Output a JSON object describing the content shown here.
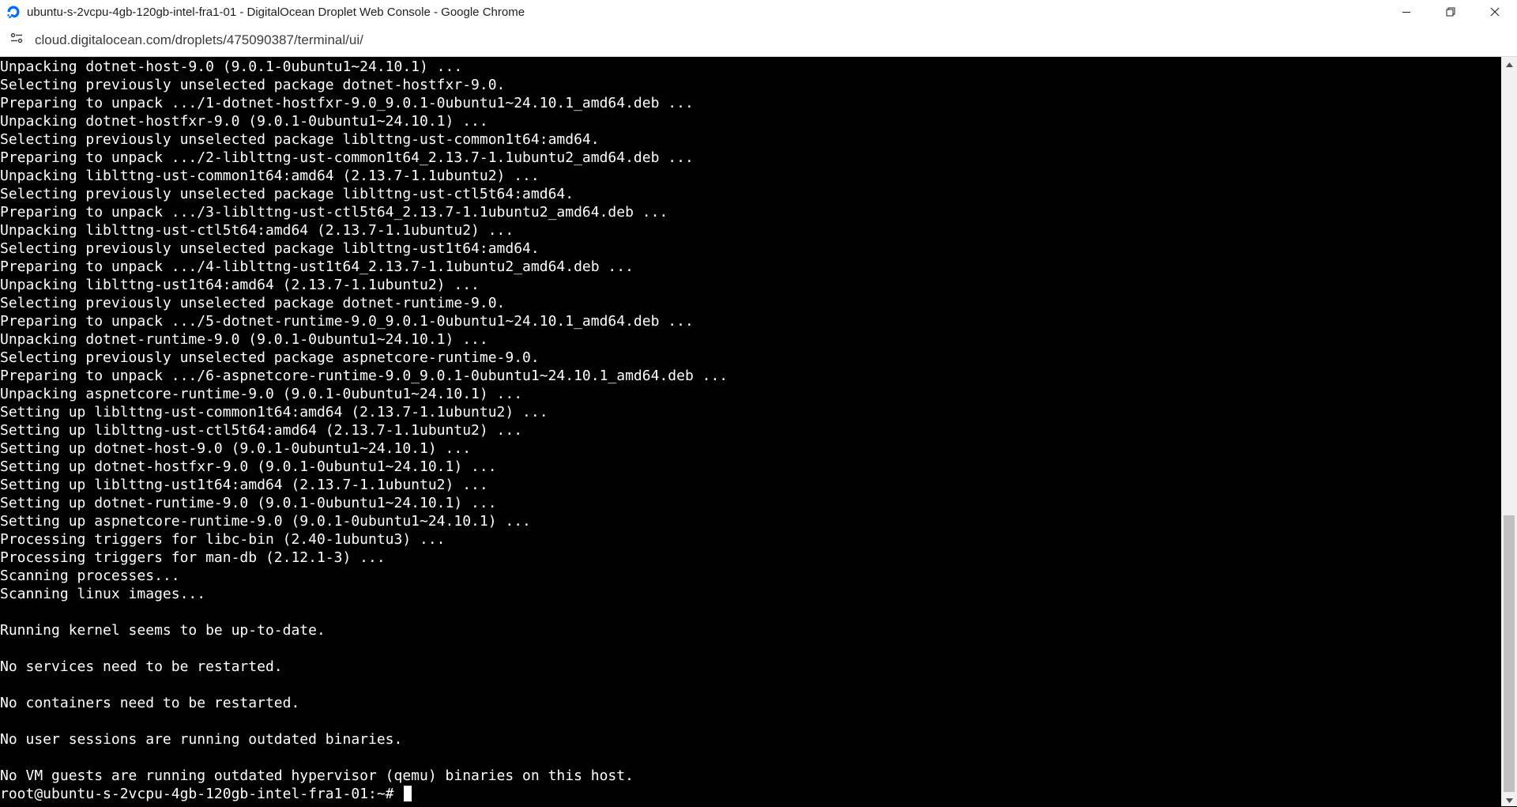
{
  "window": {
    "title": "ubuntu-s-2vcpu-4gb-120gb-intel-fra1-01 - DigitalOcean Droplet Web Console - Google Chrome",
    "icon": "digitalocean-logo-icon",
    "controls": [
      "minimize-icon",
      "restore-icon",
      "close-icon"
    ]
  },
  "addressbar": {
    "site_info_icon": "site-settings-icon",
    "url": "cloud.digitalocean.com/droplets/475090387/terminal/ui/"
  },
  "terminal": {
    "lines": [
      "Unpacking dotnet-host-9.0 (9.0.1-0ubuntu1~24.10.1) ...",
      "Selecting previously unselected package dotnet-hostfxr-9.0.",
      "Preparing to unpack .../1-dotnet-hostfxr-9.0_9.0.1-0ubuntu1~24.10.1_amd64.deb ...",
      "Unpacking dotnet-hostfxr-9.0 (9.0.1-0ubuntu1~24.10.1) ...",
      "Selecting previously unselected package liblttng-ust-common1t64:amd64.",
      "Preparing to unpack .../2-liblttng-ust-common1t64_2.13.7-1.1ubuntu2_amd64.deb ...",
      "Unpacking liblttng-ust-common1t64:amd64 (2.13.7-1.1ubuntu2) ...",
      "Selecting previously unselected package liblttng-ust-ctl5t64:amd64.",
      "Preparing to unpack .../3-liblttng-ust-ctl5t64_2.13.7-1.1ubuntu2_amd64.deb ...",
      "Unpacking liblttng-ust-ctl5t64:amd64 (2.13.7-1.1ubuntu2) ...",
      "Selecting previously unselected package liblttng-ust1t64:amd64.",
      "Preparing to unpack .../4-liblttng-ust1t64_2.13.7-1.1ubuntu2_amd64.deb ...",
      "Unpacking liblttng-ust1t64:amd64 (2.13.7-1.1ubuntu2) ...",
      "Selecting previously unselected package dotnet-runtime-9.0.",
      "Preparing to unpack .../5-dotnet-runtime-9.0_9.0.1-0ubuntu1~24.10.1_amd64.deb ...",
      "Unpacking dotnet-runtime-9.0 (9.0.1-0ubuntu1~24.10.1) ...",
      "Selecting previously unselected package aspnetcore-runtime-9.0.",
      "Preparing to unpack .../6-aspnetcore-runtime-9.0_9.0.1-0ubuntu1~24.10.1_amd64.deb ...",
      "Unpacking aspnetcore-runtime-9.0 (9.0.1-0ubuntu1~24.10.1) ...",
      "Setting up liblttng-ust-common1t64:amd64 (2.13.7-1.1ubuntu2) ...",
      "Setting up liblttng-ust-ctl5t64:amd64 (2.13.7-1.1ubuntu2) ...",
      "Setting up dotnet-host-9.0 (9.0.1-0ubuntu1~24.10.1) ...",
      "Setting up dotnet-hostfxr-9.0 (9.0.1-0ubuntu1~24.10.1) ...",
      "Setting up liblttng-ust1t64:amd64 (2.13.7-1.1ubuntu2) ...",
      "Setting up dotnet-runtime-9.0 (9.0.1-0ubuntu1~24.10.1) ...",
      "Setting up aspnetcore-runtime-9.0 (9.0.1-0ubuntu1~24.10.1) ...",
      "Processing triggers for libc-bin (2.40-1ubuntu3) ...",
      "Processing triggers for man-db (2.12.1-3) ...",
      "Scanning processes...",
      "Scanning linux images...",
      "",
      "Running kernel seems to be up-to-date.",
      "",
      "No services need to be restarted.",
      "",
      "No containers need to be restarted.",
      "",
      "No user sessions are running outdated binaries.",
      "",
      "No VM guests are running outdated hypervisor (qemu) binaries on this host."
    ],
    "prompt": "root@ubuntu-s-2vcpu-4gb-120gb-intel-fra1-01:~# "
  },
  "colors": {
    "terminal_bg": "#000000",
    "terminal_fg": "#ffffff",
    "brand": "#0069ff"
  }
}
